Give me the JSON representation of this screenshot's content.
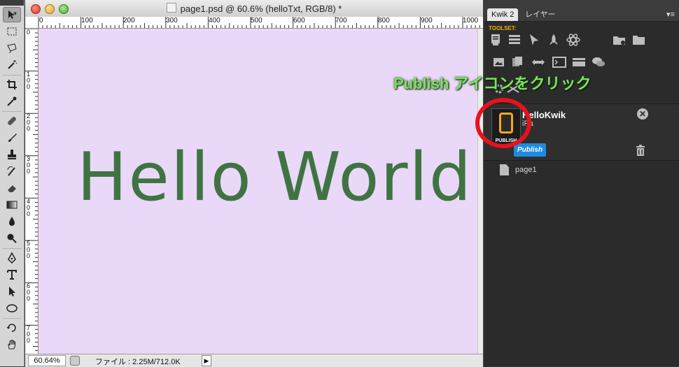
{
  "document": {
    "title": "page1.psd @ 60.6% (helloTxt, RGB/8) *",
    "canvas_text": "Hello World",
    "canvas_bg": "#ead8f8",
    "text_color": "#3f7442"
  },
  "ruler": {
    "h_labels": [
      "0",
      "100",
      "200",
      "300",
      "400",
      "500",
      "600",
      "700",
      "800",
      "900",
      "1000"
    ],
    "v_labels": [
      "0",
      "100",
      "200",
      "300",
      "400",
      "500",
      "600",
      "700"
    ]
  },
  "status": {
    "zoom": "60.64%",
    "file_info": "ファイル : 2.25M/712.0K",
    "arrow": "▶"
  },
  "panel": {
    "tabs": [
      "Kwik 2",
      "レイヤー"
    ],
    "toolset_label": "TOOLSET:",
    "project_name": "HelloKwik",
    "project_device": "iPa",
    "publish_tile_caption": "PUBLISH",
    "publish_button": "Publish",
    "page_item": "page1"
  },
  "callout": {
    "text": "Publish アイコンをクリック",
    "color": "#7be25e",
    "circle_color": "#e8121c"
  },
  "tools": [
    "move-icon",
    "marquee-icon",
    "lasso-icon",
    "magic-wand-icon",
    "crop-icon",
    "eyedropper-icon",
    "healing-icon",
    "brush-icon",
    "stamp-icon",
    "history-brush-icon",
    "eraser-icon",
    "gradient-icon",
    "blur-icon",
    "dodge-icon",
    "pen-icon",
    "type-icon",
    "path-select-icon",
    "shape-icon",
    "rotate-view-icon",
    "hand-icon"
  ]
}
